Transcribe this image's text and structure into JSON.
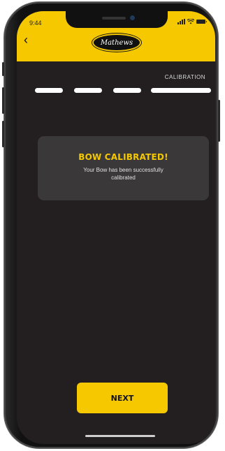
{
  "status_bar": {
    "time": "9:44"
  },
  "header": {
    "logo_text": "Mathews",
    "back_glyph": "‹"
  },
  "progress": {
    "current_step_label": "CALIBRATION",
    "steps_total": 4
  },
  "message": {
    "title": "BOW CALIBRATED!",
    "body": "Your Bow has been successfully calibrated"
  },
  "actions": {
    "next_label": "NEXT"
  },
  "colors": {
    "accent": "#f5c800",
    "background": "#231f20",
    "card": "#3a3839"
  }
}
